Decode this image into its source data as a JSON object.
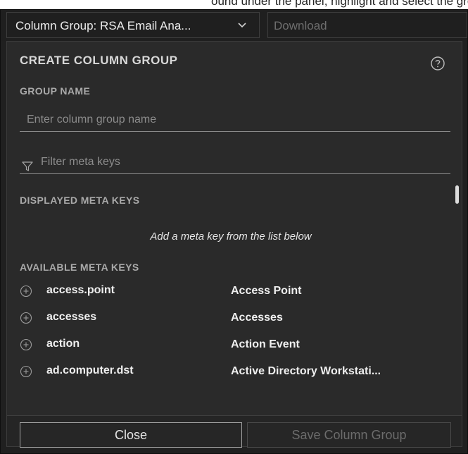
{
  "top_partial_text": "ound under the panel, highlight and select the group and display the",
  "toolbar": {
    "column_group_label": "Column Group: RSA Email Ana...",
    "download_label": "Download"
  },
  "panel": {
    "title": "CREATE COLUMN GROUP",
    "group_name_label": "GROUP NAME",
    "group_name_placeholder": "Enter column group name",
    "group_name_value": "",
    "filter_placeholder": "Filter meta keys",
    "filter_value": "",
    "displayed_label": "DISPLAYED META KEYS",
    "displayed_hint": "Add a meta key from the list below",
    "available_label": "AVAILABLE META KEYS",
    "available_keys": [
      {
        "key": "access.point",
        "description": "Access Point"
      },
      {
        "key": "accesses",
        "description": "Accesses"
      },
      {
        "key": "action",
        "description": "Action Event"
      },
      {
        "key": "ad.computer.dst",
        "description": "Active Directory Workstati..."
      }
    ]
  },
  "footer": {
    "close_label": "Close",
    "save_label": "Save Column Group"
  },
  "icons": {
    "chevron": "chevron-down-icon",
    "help": "help-circle-icon",
    "filter": "filter-icon",
    "add": "add-circle-icon"
  },
  "colors": {
    "background": "#202020",
    "panel": "#2a2a2a",
    "text": "#efefef",
    "muted_label": "#a9a9a9",
    "disabled": "#6c6c6c"
  }
}
